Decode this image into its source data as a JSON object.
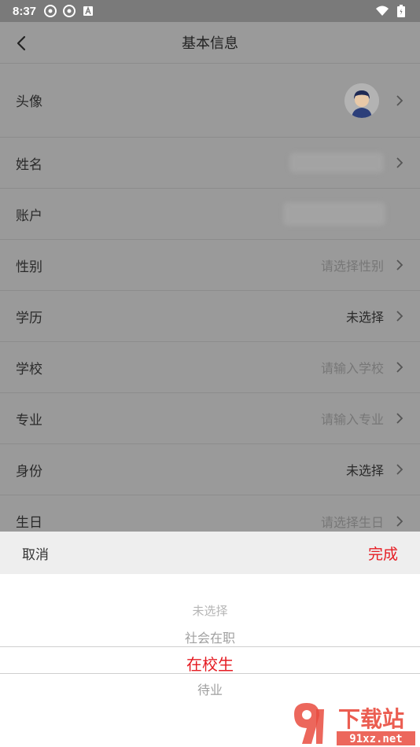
{
  "status_bar": {
    "time": "8:37",
    "icons": [
      "aperture-icon",
      "aperture-icon",
      "a-badge-icon"
    ],
    "right_icons": [
      "wifi-icon",
      "battery-icon"
    ]
  },
  "header": {
    "title": "基本信息"
  },
  "rows": [
    {
      "label": "头像",
      "value": "",
      "has_avatar": true
    },
    {
      "label": "姓名",
      "value": ""
    },
    {
      "label": "账户",
      "value": ""
    },
    {
      "label": "性别",
      "value": "请选择性别",
      "placeholder": true
    },
    {
      "label": "学历",
      "value": "未选择",
      "placeholder": false
    },
    {
      "label": "学校",
      "value": "请输入学校",
      "placeholder": true
    },
    {
      "label": "专业",
      "value": "请输入专业",
      "placeholder": true
    },
    {
      "label": "身份",
      "value": "未选择",
      "placeholder": false
    },
    {
      "label": "生日",
      "value": "请选择生日",
      "placeholder": true
    }
  ],
  "sheet": {
    "cancel": "取消",
    "done": "完成",
    "options": [
      "未选择",
      "社会在职",
      "在校生",
      "待业"
    ],
    "selected": "在校生"
  },
  "colors": {
    "accent": "#e51c23",
    "overlay_bg": "#9a9a9a"
  },
  "watermark": {
    "big": "下载站",
    "small": "91xz.net"
  }
}
